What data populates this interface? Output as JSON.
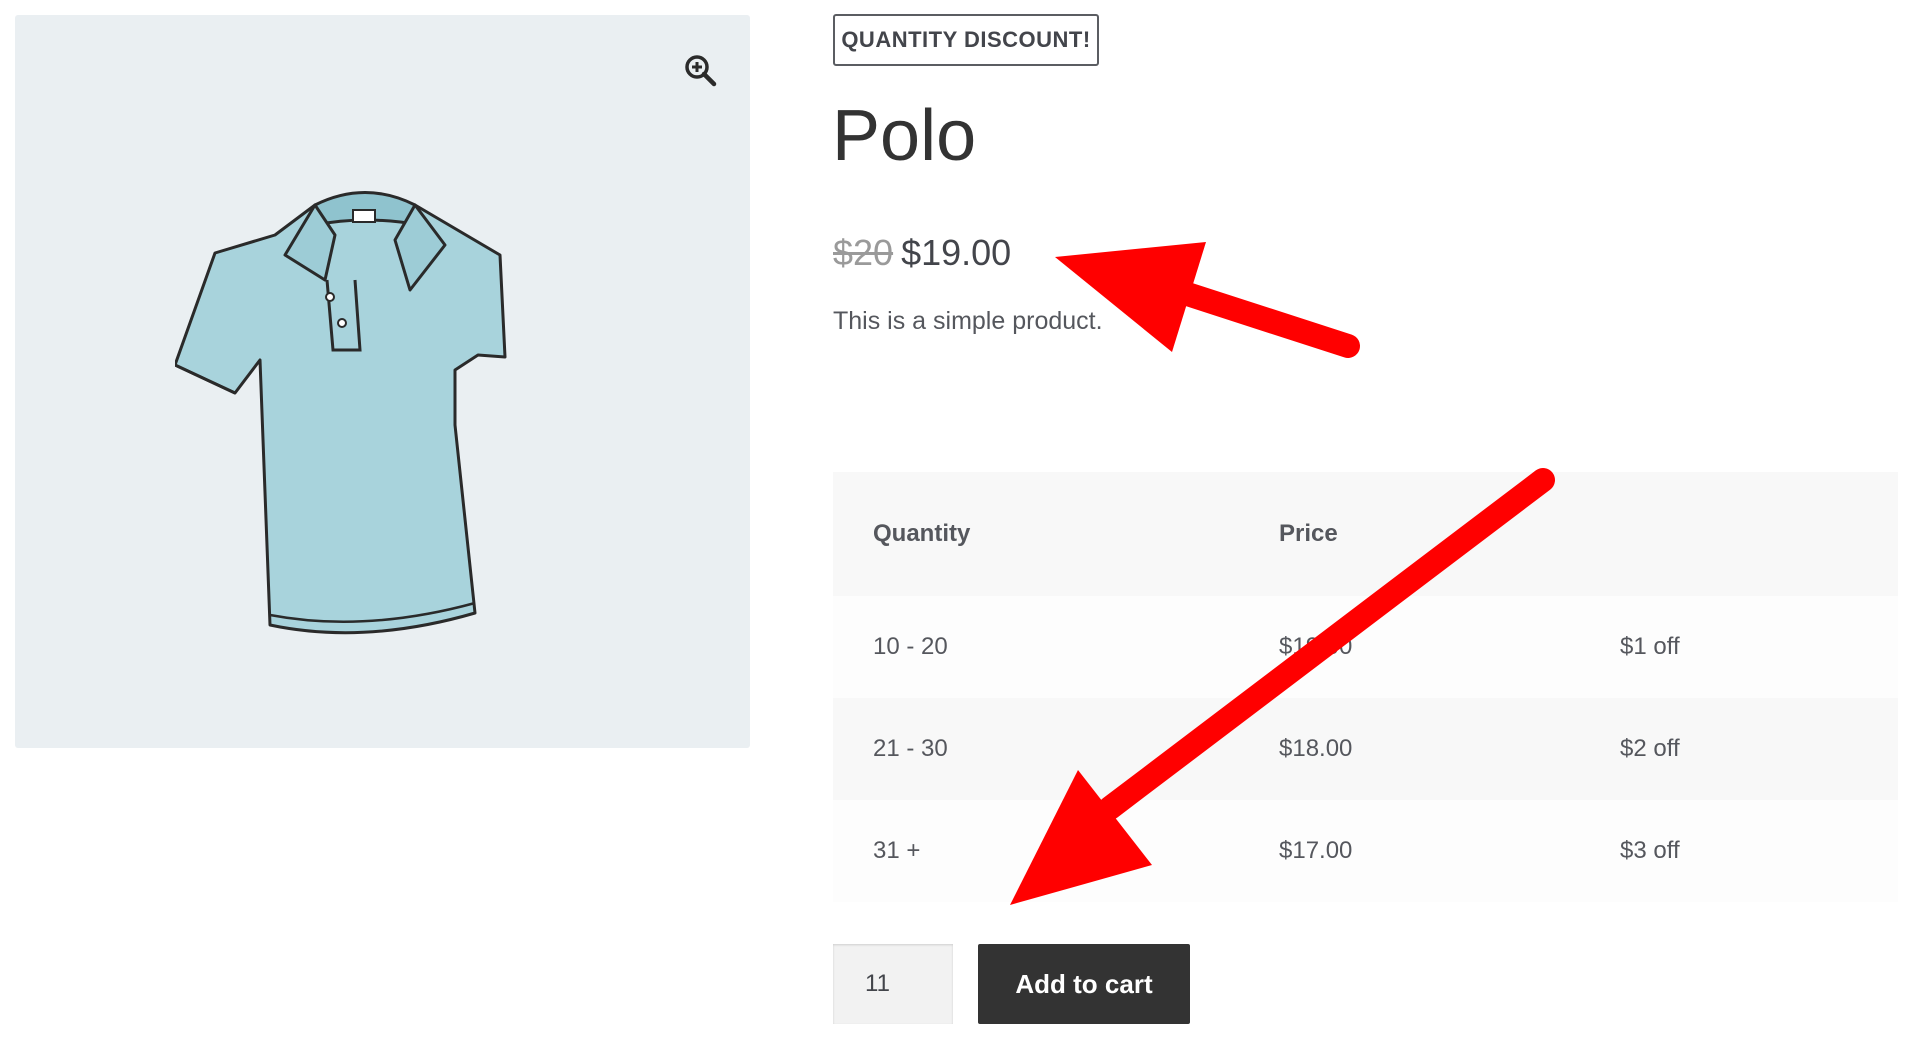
{
  "product": {
    "badge": "QUANTITY DISCOUNT!",
    "title": "Polo",
    "price_old": "$20",
    "price_new": "$19.00",
    "description": "This is a simple product."
  },
  "tier_table": {
    "headers": [
      "Quantity",
      "Price",
      ""
    ],
    "rows": [
      {
        "quantity": "10 - 20",
        "price": "$19.00",
        "discount": "$1 off"
      },
      {
        "quantity": "21 - 30",
        "price": "$18.00",
        "discount": "$2 off"
      },
      {
        "quantity": "31 +",
        "price": "$17.00",
        "discount": "$3 off"
      }
    ]
  },
  "cart": {
    "quantity_value": "11",
    "add_label": "Add to cart"
  },
  "icons": {
    "zoom": "zoom-in-icon"
  },
  "colors": {
    "gallery_bg": "#eaeff2",
    "button_bg": "#333333",
    "arrow": "#ff0000",
    "shirt": "#a8d3dc"
  }
}
